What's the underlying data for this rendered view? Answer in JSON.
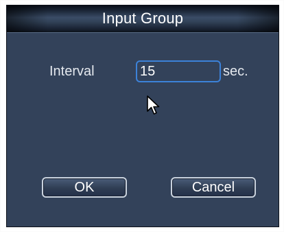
{
  "dialog": {
    "title": "Input Group"
  },
  "interval": {
    "label": "Interval",
    "value": "15",
    "unit": "sec."
  },
  "buttons": {
    "ok_label": "OK",
    "cancel_label": "Cancel"
  },
  "icons": {
    "pointer": "mouse-pointer-icon"
  },
  "colors": {
    "panel_background": "#33425a",
    "focus_border": "#3c82d9",
    "button_border": "#c9d2de"
  }
}
